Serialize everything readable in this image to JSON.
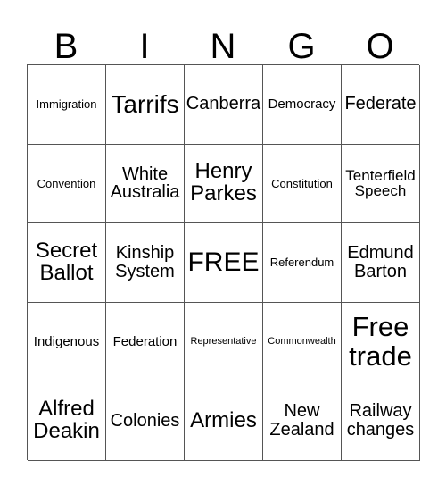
{
  "card": {
    "header_letters": [
      "B",
      "I",
      "N",
      "G",
      "O"
    ],
    "free_space_label": "FREE",
    "grid_line_color": "#555555",
    "background_color": "#ffffff",
    "text_color": "#000000",
    "rows": [
      [
        {
          "label": "Immigration",
          "size": "sm"
        },
        {
          "label": "Tarrifs",
          "size": "xxxl"
        },
        {
          "label": "Canberra",
          "size": "xl"
        },
        {
          "label": "Democracy",
          "size": "md"
        },
        {
          "label": "Federate",
          "size": "xl"
        }
      ],
      [
        {
          "label": "Convention",
          "size": "sm"
        },
        {
          "label": "White Australia",
          "size": "xl"
        },
        {
          "label": "Henry Parkes",
          "size": "xxl"
        },
        {
          "label": "Constitution",
          "size": "sm"
        },
        {
          "label": "Tenterfield Speech",
          "size": "lg"
        }
      ],
      [
        {
          "label": "Secret Ballot",
          "size": "xxl"
        },
        {
          "label": "Kinship System",
          "size": "xl"
        },
        {
          "label": "FREE",
          "size": "free"
        },
        {
          "label": "Referendum",
          "size": "sm"
        },
        {
          "label": "Edmund Barton",
          "size": "xl"
        }
      ],
      [
        {
          "label": "Indigenous",
          "size": "md"
        },
        {
          "label": "Federation",
          "size": "md"
        },
        {
          "label": "Representative",
          "size": "xs"
        },
        {
          "label": "Commonwealth",
          "size": "xs"
        },
        {
          "label": "Free trade",
          "size": "huge"
        }
      ],
      [
        {
          "label": "Alfred Deakin",
          "size": "xxl"
        },
        {
          "label": "Colonies",
          "size": "xl"
        },
        {
          "label": "Armies",
          "size": "xxl"
        },
        {
          "label": "New Zealand",
          "size": "xl"
        },
        {
          "label": "Railway changes",
          "size": "xl"
        }
      ]
    ]
  }
}
